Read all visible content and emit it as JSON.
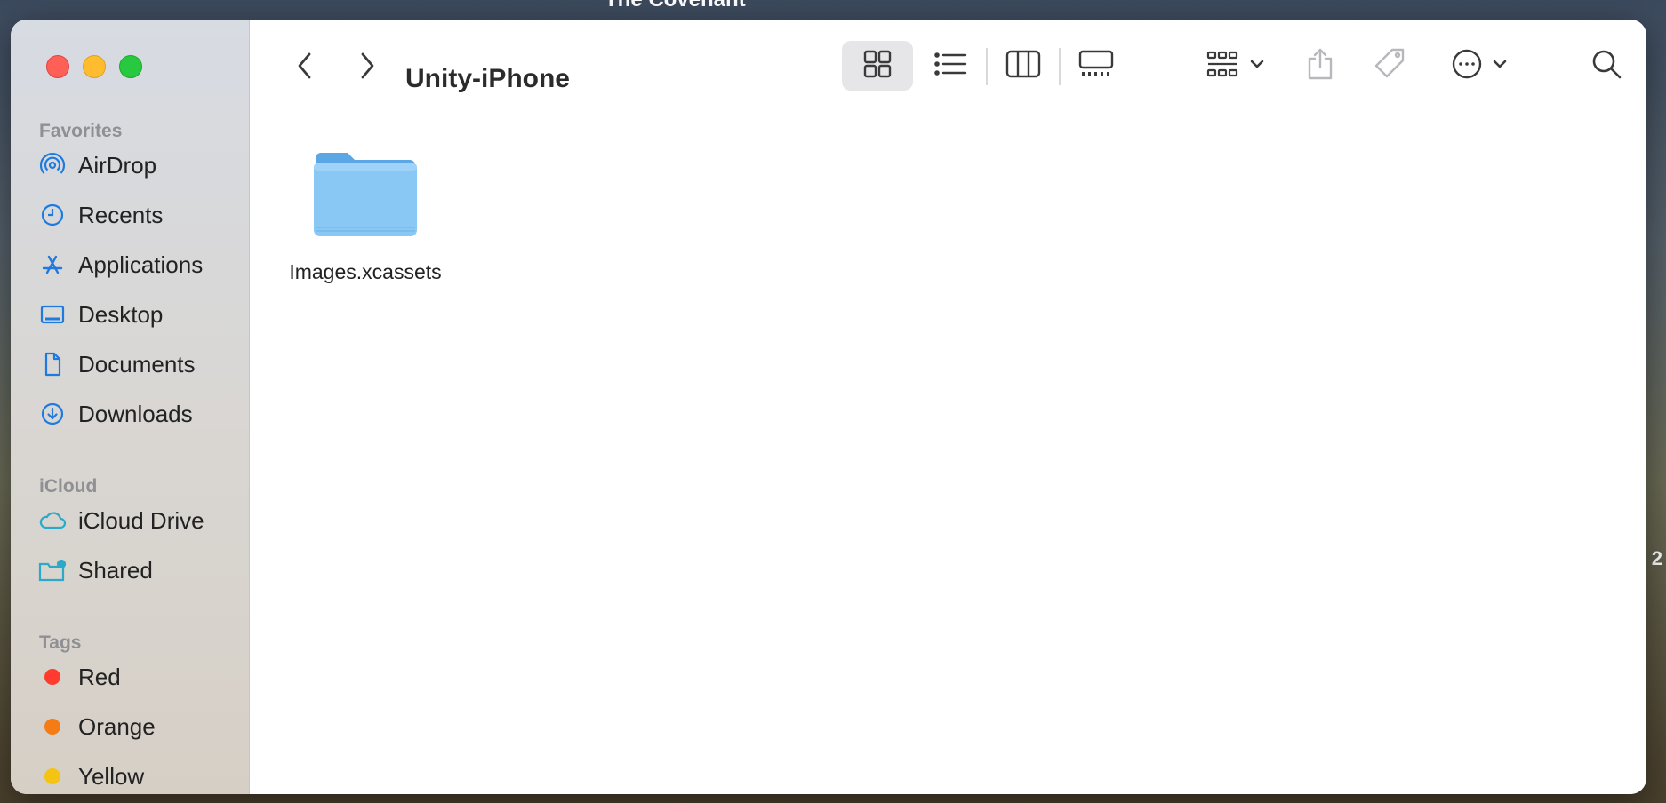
{
  "desktop": {
    "background_title": "The Covenant",
    "edge_label": "2"
  },
  "window": {
    "title": "Unity-iPhone",
    "colors": {
      "accent": "#1f7ae0",
      "sidebar_icon": "#1f7ae0",
      "folder": "#89c7f5"
    }
  },
  "sidebar": {
    "sections": [
      {
        "label": "Favorites",
        "items": [
          {
            "label": "AirDrop",
            "icon": "airdrop-icon"
          },
          {
            "label": "Recents",
            "icon": "clock-icon"
          },
          {
            "label": "Applications",
            "icon": "applications-icon"
          },
          {
            "label": "Desktop",
            "icon": "desktop-icon"
          },
          {
            "label": "Documents",
            "icon": "document-icon"
          },
          {
            "label": "Downloads",
            "icon": "download-icon"
          }
        ]
      },
      {
        "label": "iCloud",
        "items": [
          {
            "label": "iCloud Drive",
            "icon": "cloud-icon"
          },
          {
            "label": "Shared",
            "icon": "shared-folder-icon"
          }
        ]
      },
      {
        "label": "Tags",
        "items": [
          {
            "label": "Red",
            "color": "#ff3b30"
          },
          {
            "label": "Orange",
            "color": "#f57c14"
          },
          {
            "label": "Yellow",
            "color": "#f5c311"
          }
        ]
      }
    ]
  },
  "toolbar": {
    "back_icon": "chevron-left-icon",
    "forward_icon": "chevron-right-icon",
    "views": [
      "icon-view-icon",
      "list-view-icon",
      "column-view-icon",
      "gallery-view-icon"
    ],
    "active_view": "icon-view-icon",
    "actions": [
      "group-by-icon",
      "share-icon",
      "tag-icon",
      "more-icon",
      "search-icon"
    ]
  },
  "files": [
    {
      "name": "Images.xcassets",
      "kind": "folder"
    }
  ]
}
